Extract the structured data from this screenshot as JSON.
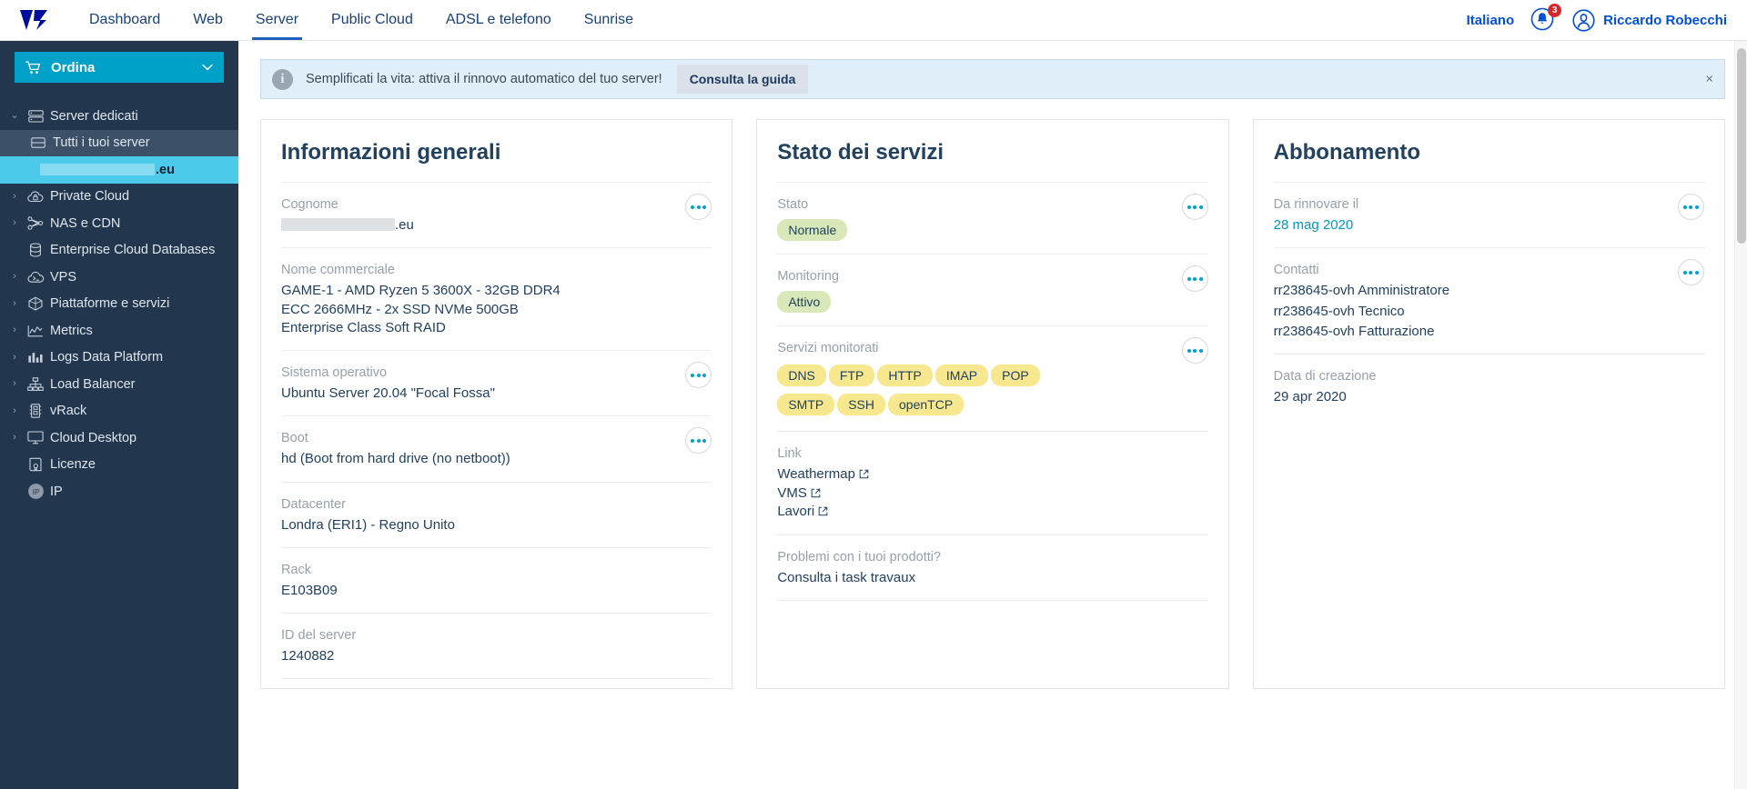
{
  "header": {
    "nav": [
      {
        "label": "Dashboard",
        "active": false
      },
      {
        "label": "Web",
        "active": false
      },
      {
        "label": "Server",
        "active": true
      },
      {
        "label": "Public Cloud",
        "active": false
      },
      {
        "label": "ADSL e telefono",
        "active": false
      },
      {
        "label": "Sunrise",
        "active": false
      }
    ],
    "language": "Italiano",
    "notification_count": "3",
    "user_name": "Riccardo Robecchi"
  },
  "sidebar": {
    "order_label": "Ordina",
    "items": [
      {
        "label": "Server dedicati",
        "icon": "server-icon",
        "arrow": "⌄",
        "state": "expanded"
      },
      {
        "label": "Tutti i tuoi server",
        "icon": "server-icon",
        "arrow": "",
        "state": "sub-selected"
      },
      {
        "label": ".eu",
        "icon": "",
        "arrow": "",
        "state": "sub-active-redacted"
      },
      {
        "label": "Private Cloud",
        "icon": "private-cloud-icon",
        "arrow": "›",
        "state": "collapsed"
      },
      {
        "label": "NAS e CDN",
        "icon": "nas-cdn-icon",
        "arrow": "›",
        "state": "collapsed"
      },
      {
        "label": "Enterprise Cloud Databases",
        "icon": "database-icon",
        "arrow": "",
        "state": "leaf"
      },
      {
        "label": "VPS",
        "icon": "vps-icon",
        "arrow": "›",
        "state": "collapsed"
      },
      {
        "label": "Piattaforme e servizi",
        "icon": "platform-icon",
        "arrow": "›",
        "state": "collapsed"
      },
      {
        "label": "Metrics",
        "icon": "metrics-icon",
        "arrow": "›",
        "state": "collapsed"
      },
      {
        "label": "Logs Data Platform",
        "icon": "logs-icon",
        "arrow": "›",
        "state": "collapsed"
      },
      {
        "label": "Load Balancer",
        "icon": "load-balancer-icon",
        "arrow": "›",
        "state": "collapsed"
      },
      {
        "label": "vRack",
        "icon": "vrack-icon",
        "arrow": "›",
        "state": "collapsed"
      },
      {
        "label": "Cloud Desktop",
        "icon": "desktop-icon",
        "arrow": "›",
        "state": "collapsed"
      },
      {
        "label": "Licenze",
        "icon": "license-icon",
        "arrow": "",
        "state": "leaf"
      },
      {
        "label": "IP",
        "icon": "ip-icon",
        "arrow": "",
        "state": "leaf"
      }
    ]
  },
  "banner": {
    "message": "Semplificati la vita: attiva il rinnovo automatico del tuo server!",
    "button": "Consulta la guida",
    "close": "×"
  },
  "cards": {
    "general": {
      "title": "Informazioni generali",
      "rows": [
        {
          "label": "Cognome",
          "value": ".eu",
          "redacted": true,
          "menu": true
        },
        {
          "label": "Nome commerciale",
          "value": "GAME-1 - AMD Ryzen 5 3600X - 32GB DDR4 ECC 2666MHz - 2x SSD NVMe 500GB Enterprise Class Soft RAID",
          "menu": false
        },
        {
          "label": "Sistema operativo",
          "value": "Ubuntu Server 20.04 \"Focal Fossa\"",
          "menu": true
        },
        {
          "label": "Boot",
          "value": "hd (Boot from hard drive (no netboot))",
          "menu": true
        },
        {
          "label": "Datacenter",
          "value": "Londra (ERI1) - Regno Unito",
          "menu": false
        },
        {
          "label": "Rack",
          "value": "E103B09",
          "menu": false
        },
        {
          "label": "ID del server",
          "value": "1240882",
          "menu": false
        }
      ]
    },
    "services": {
      "title": "Stato dei servizi",
      "status_label": "Stato",
      "status_value": "Normale",
      "monitoring_label": "Monitoring",
      "monitoring_value": "Attivo",
      "monitored_label": "Servizi monitorati",
      "monitored_services": [
        "DNS",
        "FTP",
        "HTTP",
        "IMAP",
        "POP",
        "SMTP",
        "SSH",
        "openTCP"
      ],
      "links_label": "Link",
      "links": [
        "Weathermap",
        "VMS",
        "Lavori"
      ],
      "problems_label": "Problemi con i tuoi prodotti?",
      "problems_value": "Consulta i task travaux"
    },
    "subscription": {
      "title": "Abbonamento",
      "renew_label": "Da rinnovare il",
      "renew_value": "28 mag 2020",
      "contacts_label": "Contatti",
      "contacts": [
        "rr238645-ovh Amministratore",
        "rr238645-ovh Tecnico",
        "rr238645-ovh Fatturazione"
      ],
      "created_label": "Data di creazione",
      "created_value": "29 apr 2020"
    }
  }
}
